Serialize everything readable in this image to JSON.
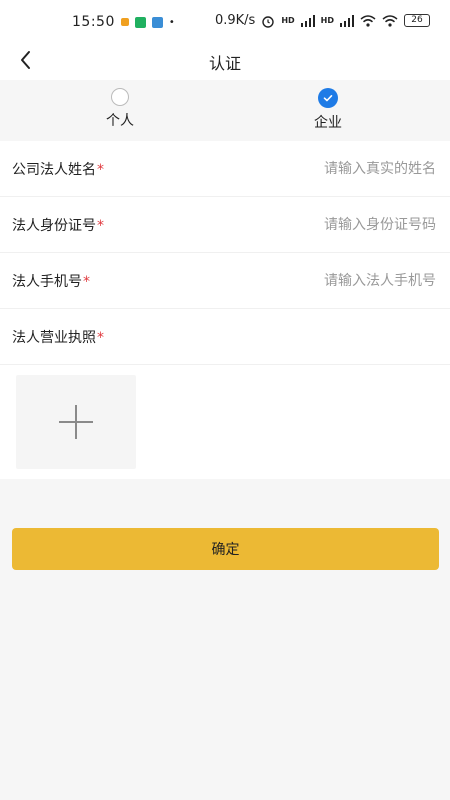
{
  "status_bar": {
    "time": "15:50",
    "network_speed": "0.9K/s",
    "battery": "26",
    "signal_label": "HD"
  },
  "nav": {
    "title": "认证"
  },
  "account_type": {
    "options": [
      {
        "label": "个人",
        "selected": false
      },
      {
        "label": "企业",
        "selected": true
      }
    ]
  },
  "form": {
    "fields": [
      {
        "label": "公司法人姓名",
        "required_mark": "*",
        "placeholder": "请输入真实的姓名",
        "value": ""
      },
      {
        "label": "法人身份证号",
        "required_mark": "*",
        "placeholder": "请输入身份证号码",
        "value": ""
      },
      {
        "label": "法人手机号",
        "required_mark": "*",
        "placeholder": "请输入法人手机号",
        "value": ""
      }
    ],
    "license": {
      "label": "法人营业执照",
      "required_mark": "*"
    }
  },
  "actions": {
    "confirm_label": "确定"
  },
  "colors": {
    "accent": "#ecb934",
    "radio_selected": "#1e7be6",
    "required": "#e0393e"
  }
}
